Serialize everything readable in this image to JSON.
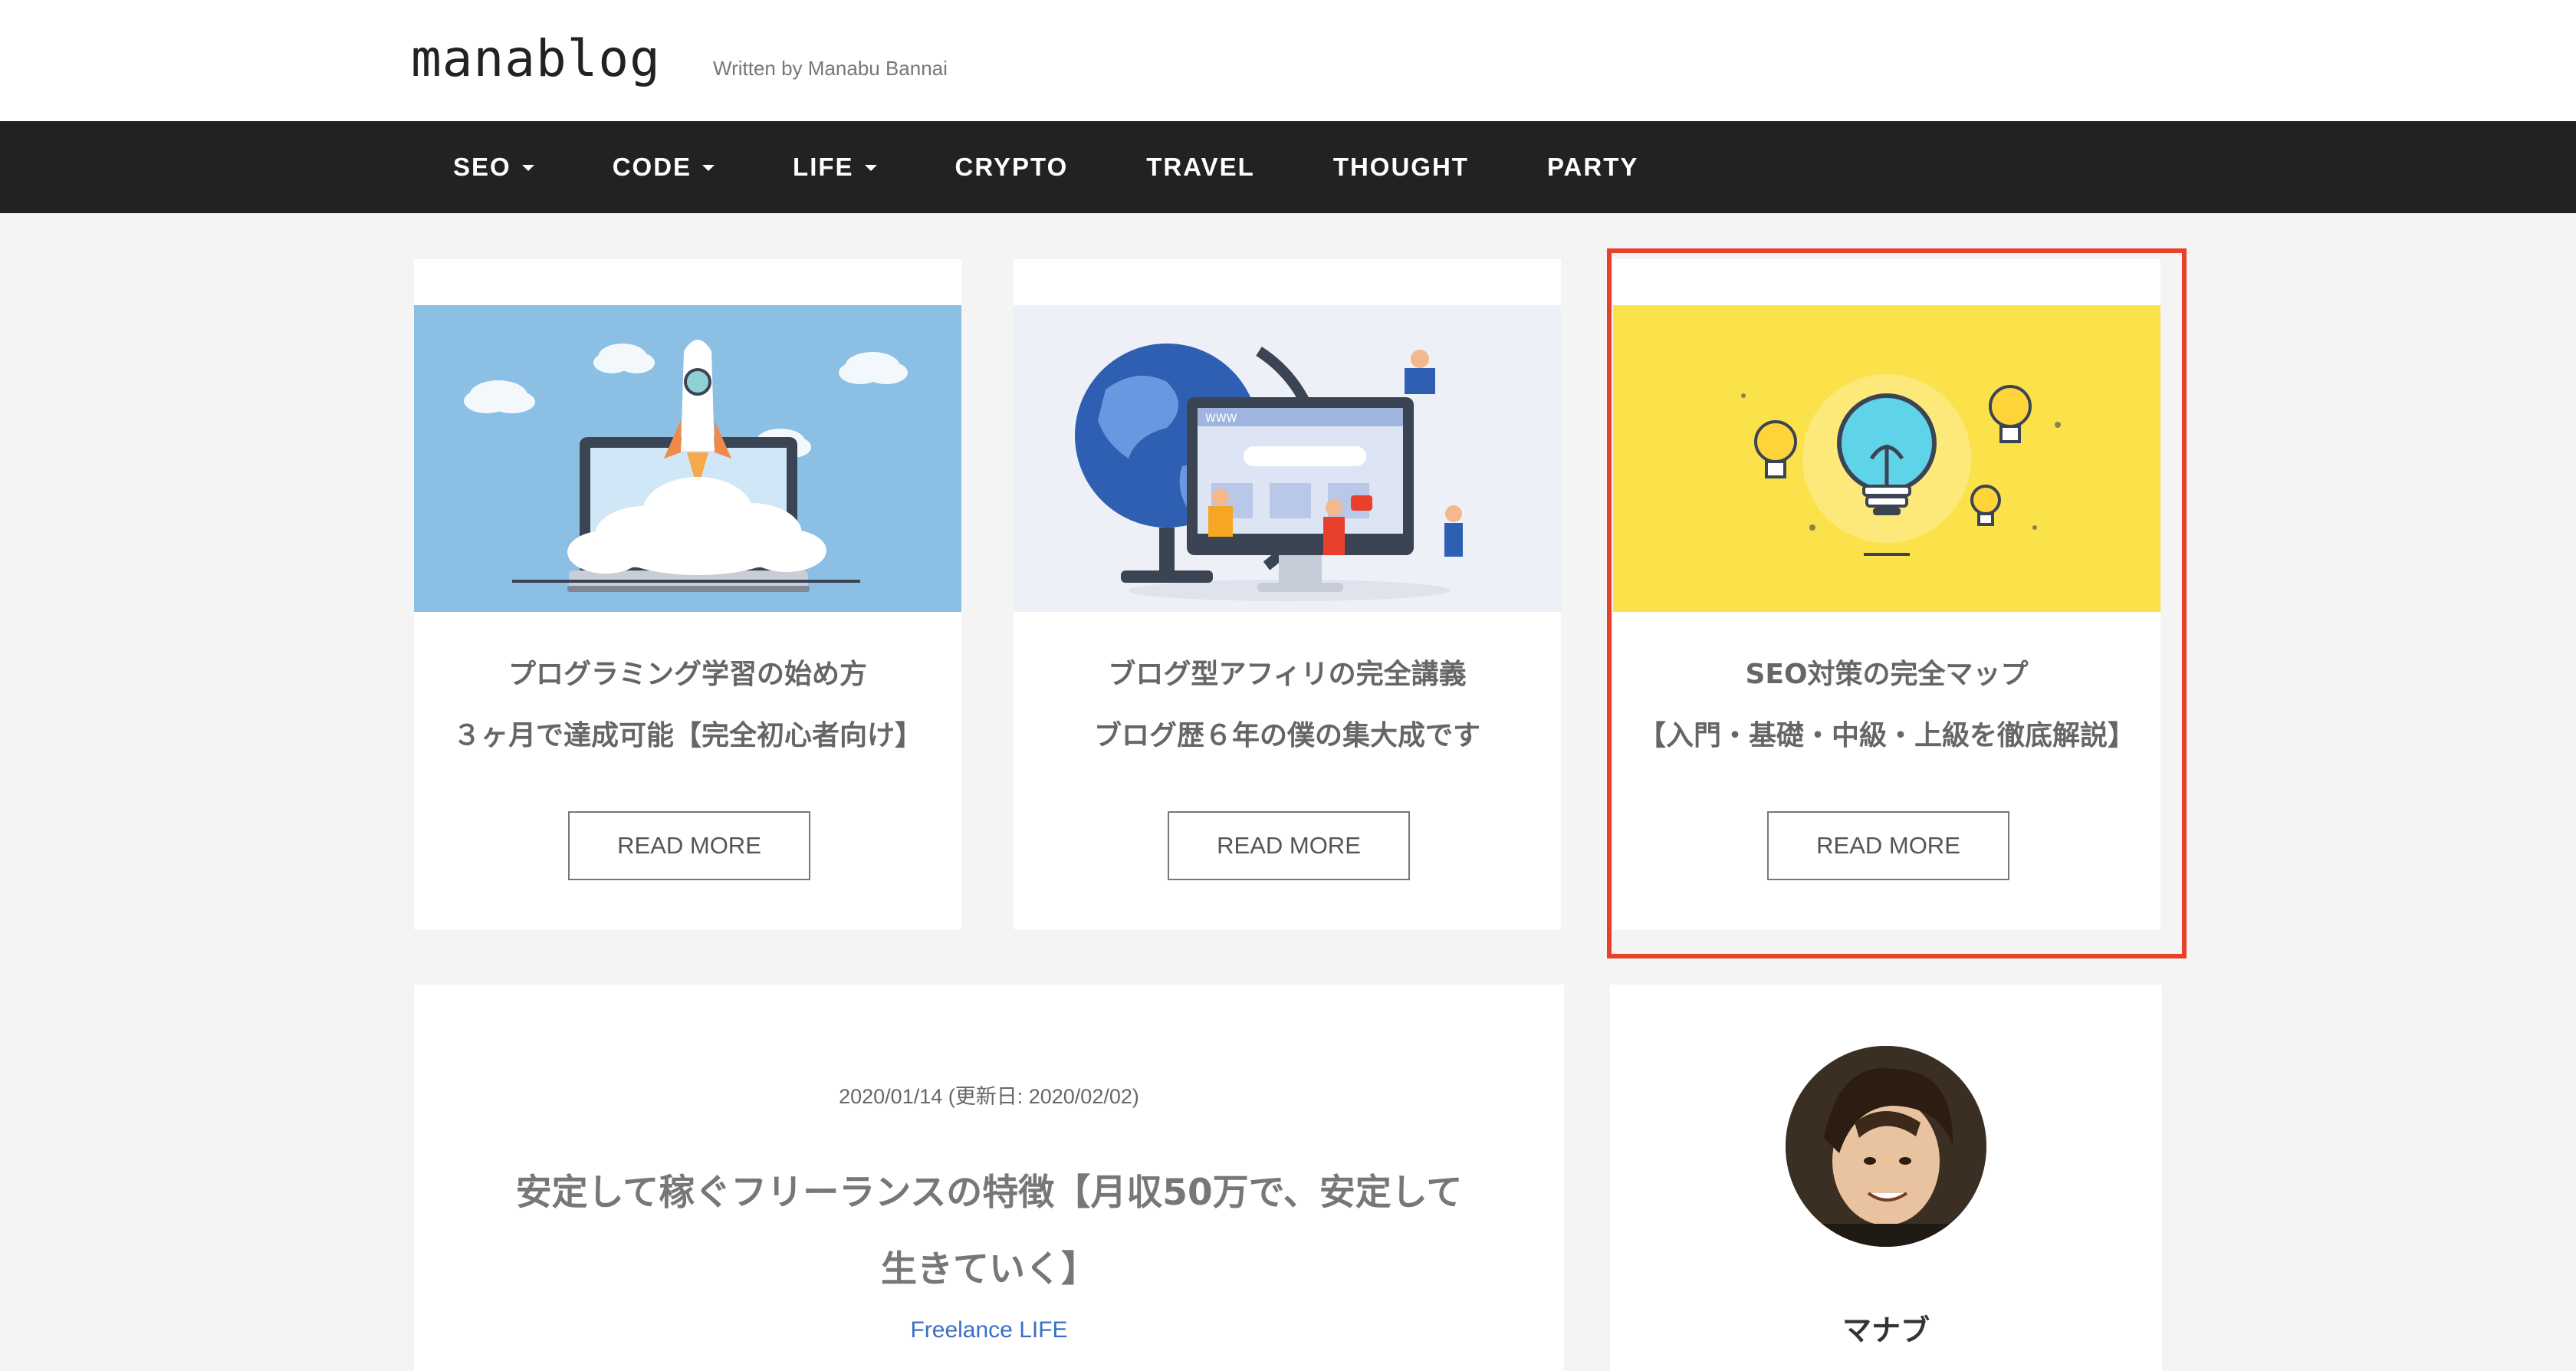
{
  "header": {
    "logo": "manablog",
    "tagline": "Written by Manabu Bannai"
  },
  "nav": {
    "items": [
      {
        "label": "SEO",
        "dropdown": true
      },
      {
        "label": "CODE",
        "dropdown": true
      },
      {
        "label": "LIFE",
        "dropdown": true
      },
      {
        "label": "CRYPTO",
        "dropdown": false
      },
      {
        "label": "TRAVEL",
        "dropdown": false
      },
      {
        "label": "THOUGHT",
        "dropdown": false
      },
      {
        "label": "PARTY",
        "dropdown": false
      }
    ]
  },
  "cards": [
    {
      "line1": "プログラミング学習の始め方",
      "line2": "３ヶ月で達成可能【完全初心者向け】",
      "button": "READ MORE",
      "image": "rocket-laptop-illustration"
    },
    {
      "line1": "ブログ型アフィリの完全講義",
      "line2": "ブログ歴６年の僕の集大成です",
      "button": "READ MORE",
      "image": "globe-monitor-illustration"
    },
    {
      "line1": "SEO対策の完全マップ",
      "line2": "【入門・基礎・中級・上級を徹底解説】",
      "button": "READ MORE",
      "image": "lightbulb-illustration",
      "highlighted": true
    }
  ],
  "post": {
    "date": "2020/01/14 (更新日: 2020/02/02)",
    "title_line1": "安定して稼ぐフリーランスの特徴【月収50万で、安定して",
    "title_line2": "生きていく】",
    "category": "Freelance LIFE"
  },
  "profile": {
    "name": "マナブ"
  },
  "colors": {
    "nav_bg": "#222222",
    "highlight": "#e8402a",
    "link": "#3a6fc4",
    "card1_bg": "#8bbfe3",
    "card2_bg": "#eef0f7",
    "card3_bg": "#fbe14a"
  }
}
